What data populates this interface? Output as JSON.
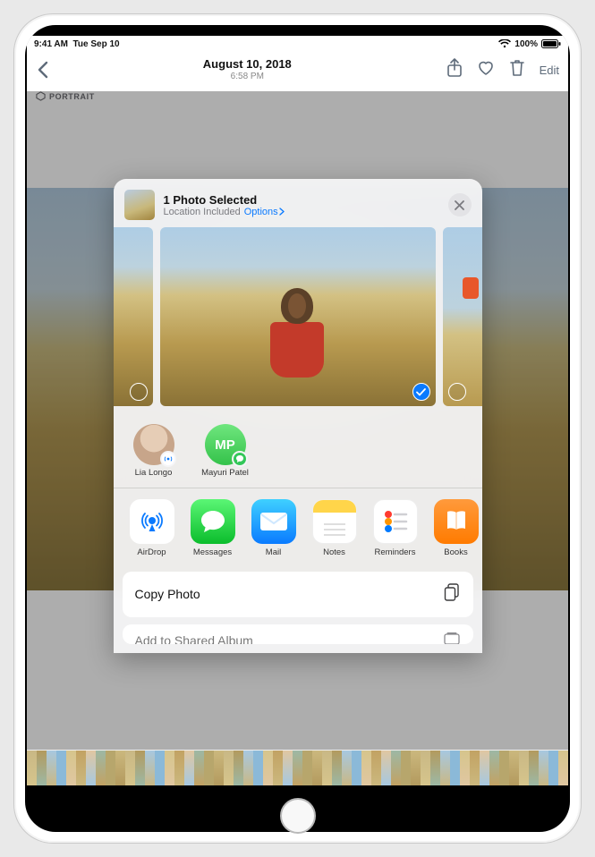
{
  "status": {
    "time": "9:41 AM",
    "date": "Tue Sep 10",
    "battery_pct": "100%"
  },
  "nav": {
    "title_date": "August 10, 2018",
    "title_time": "6:58 PM",
    "edit_label": "Edit",
    "portrait_badge": "PORTRAIT"
  },
  "sheet": {
    "title": "1 Photo Selected",
    "subtitle": "Location Included",
    "options_label": "Options",
    "contacts": [
      {
        "name": "Lia Longo",
        "initials": "",
        "avatar_color": "#c7a58a",
        "sub_kind": "airdrop"
      },
      {
        "name": "Mayuri Patel",
        "initials": "MP",
        "avatar_color": "#4fc15a",
        "sub_kind": "messages"
      }
    ],
    "apps": [
      {
        "label": "AirDrop",
        "kind": "airdrop"
      },
      {
        "label": "Messages",
        "kind": "messages"
      },
      {
        "label": "Mail",
        "kind": "mail"
      },
      {
        "label": "Notes",
        "kind": "notes"
      },
      {
        "label": "Reminders",
        "kind": "reminders"
      },
      {
        "label": "Books",
        "kind": "books"
      }
    ],
    "actions": {
      "copy_photo": "Copy Photo",
      "add_to_shared_album": "Add to Shared Album"
    }
  }
}
